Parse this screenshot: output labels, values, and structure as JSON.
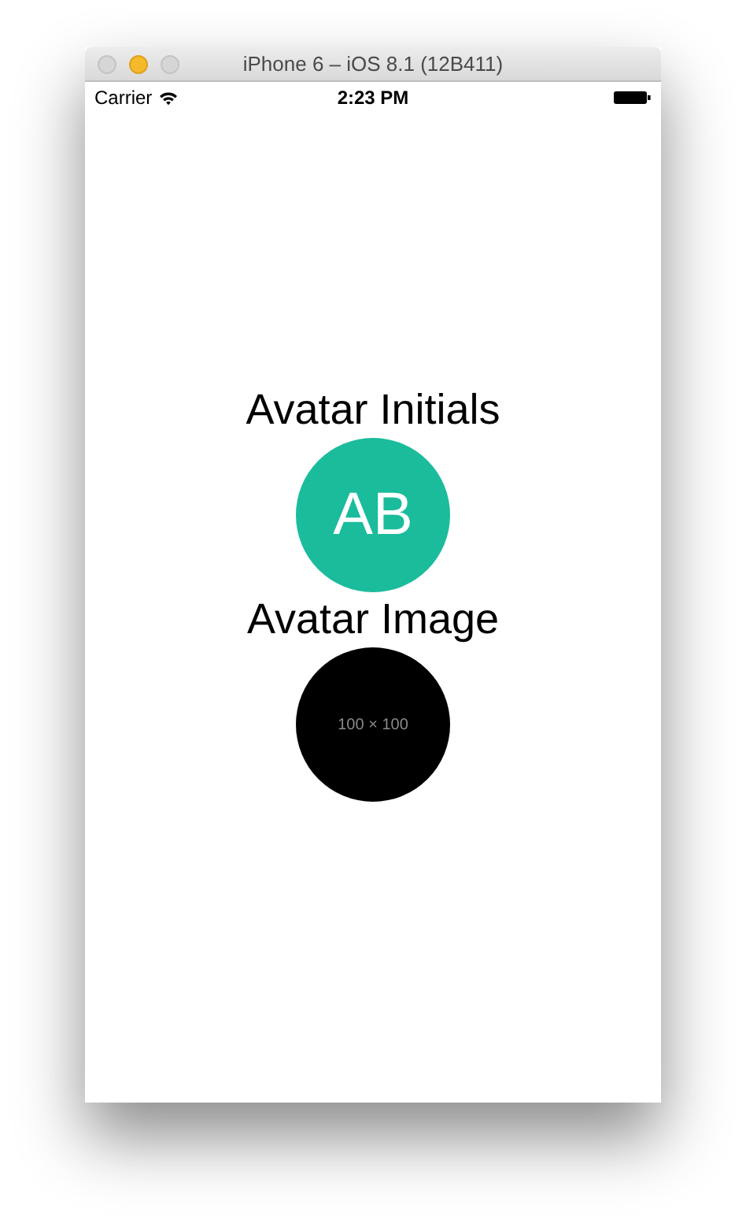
{
  "window": {
    "title": "iPhone 6 – iOS 8.1 (12B411)"
  },
  "status_bar": {
    "carrier": "Carrier",
    "time": "2:23 PM"
  },
  "sections": [
    {
      "title": "Avatar Initials",
      "avatar": {
        "kind": "initials",
        "text": "AB",
        "color": "#1abc9c"
      }
    },
    {
      "title": "Avatar Image",
      "avatar": {
        "kind": "image",
        "text": "100 × 100",
        "color": "#000000"
      }
    }
  ]
}
